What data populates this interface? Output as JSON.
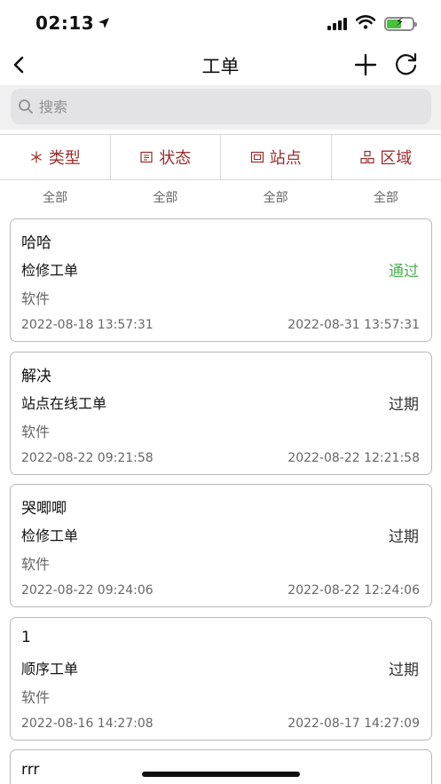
{
  "status_bar": {
    "time": "02:13"
  },
  "nav": {
    "title": "工单"
  },
  "search": {
    "placeholder": "搜索"
  },
  "filters": [
    {
      "label": "类型",
      "value": "全部",
      "icon": "asterisk-icon"
    },
    {
      "label": "状态",
      "value": "全部",
      "icon": "document-icon"
    },
    {
      "label": "站点",
      "value": "全部",
      "icon": "station-icon"
    },
    {
      "label": "区域",
      "value": "全部",
      "icon": "hierarchy-icon"
    }
  ],
  "orders": [
    {
      "title": "哈哈",
      "type": "检修工单",
      "status": "通过",
      "category": "软件",
      "start": "2022-08-18 13:57:31",
      "end": "2022-08-31 13:57:31"
    },
    {
      "title": "解决",
      "type": "站点在线工单",
      "status": "过期",
      "category": "软件",
      "start": "2022-08-22 09:21:58",
      "end": "2022-08-22 12:21:58"
    },
    {
      "title": "哭唧唧",
      "type": "检修工单",
      "status": "过期",
      "category": "软件",
      "start": "2022-08-22 09:24:06",
      "end": "2022-08-22 12:24:06"
    },
    {
      "title": "1",
      "type": "顺序工单",
      "status": "过期",
      "category": "软件",
      "start": "2022-08-16 14:27:08",
      "end": "2022-08-17 14:27:09"
    },
    {
      "title": "rrr"
    }
  ],
  "colors": {
    "accent": "#9b2b2b",
    "pass": "#4caf50",
    "battery": "#49c13e"
  }
}
